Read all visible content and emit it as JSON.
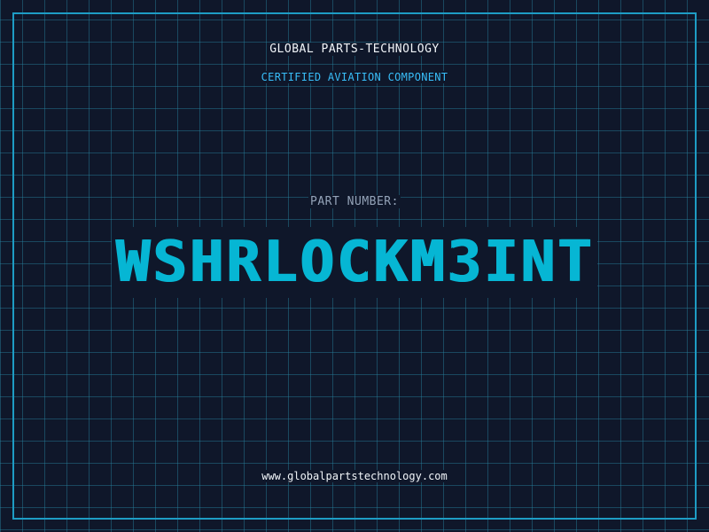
{
  "header": {
    "company": "GLOBAL PARTS-TECHNOLOGY",
    "tagline": "CERTIFIED AVIATION COMPONENT"
  },
  "part": {
    "label": "PART NUMBER:",
    "number": "WSHRLOCKM3INT"
  },
  "footer": {
    "website": "www.globalpartstechnology.com"
  },
  "colors": {
    "background": "#0f172a",
    "grid": "#2882a0",
    "border": "#1e9cc4",
    "accent": "#06b6d4",
    "tagline": "#38bdf8",
    "muted": "#94a3b8",
    "text": "#f1f5f9"
  }
}
